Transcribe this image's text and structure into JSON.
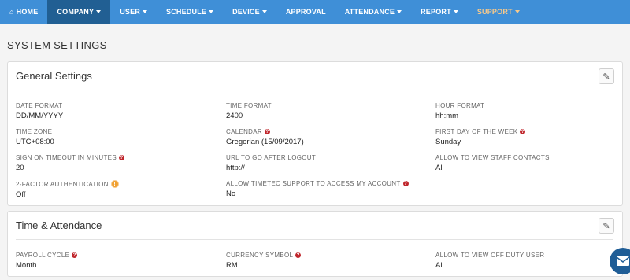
{
  "nav": {
    "items": [
      {
        "label": "HOME"
      },
      {
        "label": "COMPANY"
      },
      {
        "label": "USER"
      },
      {
        "label": "SCHEDULE"
      },
      {
        "label": "DEVICE"
      },
      {
        "label": "APPROVAL"
      },
      {
        "label": "ATTENDANCE"
      },
      {
        "label": "REPORT"
      },
      {
        "label": "SUPPORT"
      }
    ],
    "colors": {
      "bar": "#3f8fd7",
      "active": "#215f93",
      "support": "#f7c98b"
    }
  },
  "page_title": "SYSTEM SETTINGS",
  "general": {
    "title": "General Settings",
    "fields": [
      {
        "label": "DATE FORMAT",
        "value": "DD/MM/YYYY"
      },
      {
        "label": "TIME FORMAT",
        "value": "2400"
      },
      {
        "label": "HOUR FORMAT",
        "value": "hh:mm"
      },
      {
        "label": "TIME ZONE",
        "value": "UTC+08:00"
      },
      {
        "label": "CALENDAR",
        "value": "Gregorian (15/09/2017)"
      },
      {
        "label": "FIRST DAY OF THE WEEK",
        "value": "Sunday"
      },
      {
        "label": "SIGN ON TIMEOUT IN MINUTES",
        "value": "20"
      },
      {
        "label": "URL TO GO AFTER LOGOUT",
        "value": "http://"
      },
      {
        "label": "ALLOW TO VIEW STAFF CONTACTS",
        "value": "All"
      },
      {
        "label": "2-FACTOR AUTHENTICATION",
        "value": "Off"
      },
      {
        "label": "ALLOW TIMETEC SUPPORT TO ACCESS MY ACCOUNT",
        "value": "No"
      }
    ]
  },
  "attendance": {
    "title": "Time & Attendance",
    "fields": [
      {
        "label": "PAYROLL CYCLE",
        "value": "Month"
      },
      {
        "label": "CURRENCY SYMBOL",
        "value": "RM"
      },
      {
        "label": "ALLOW TO VIEW OFF DUTY USER",
        "value": "All"
      }
    ]
  },
  "icons": {
    "home": "home-icon",
    "edit": "pencil-icon",
    "help": "question-icon",
    "warning": "warning-icon",
    "chat": "envelope-icon"
  }
}
